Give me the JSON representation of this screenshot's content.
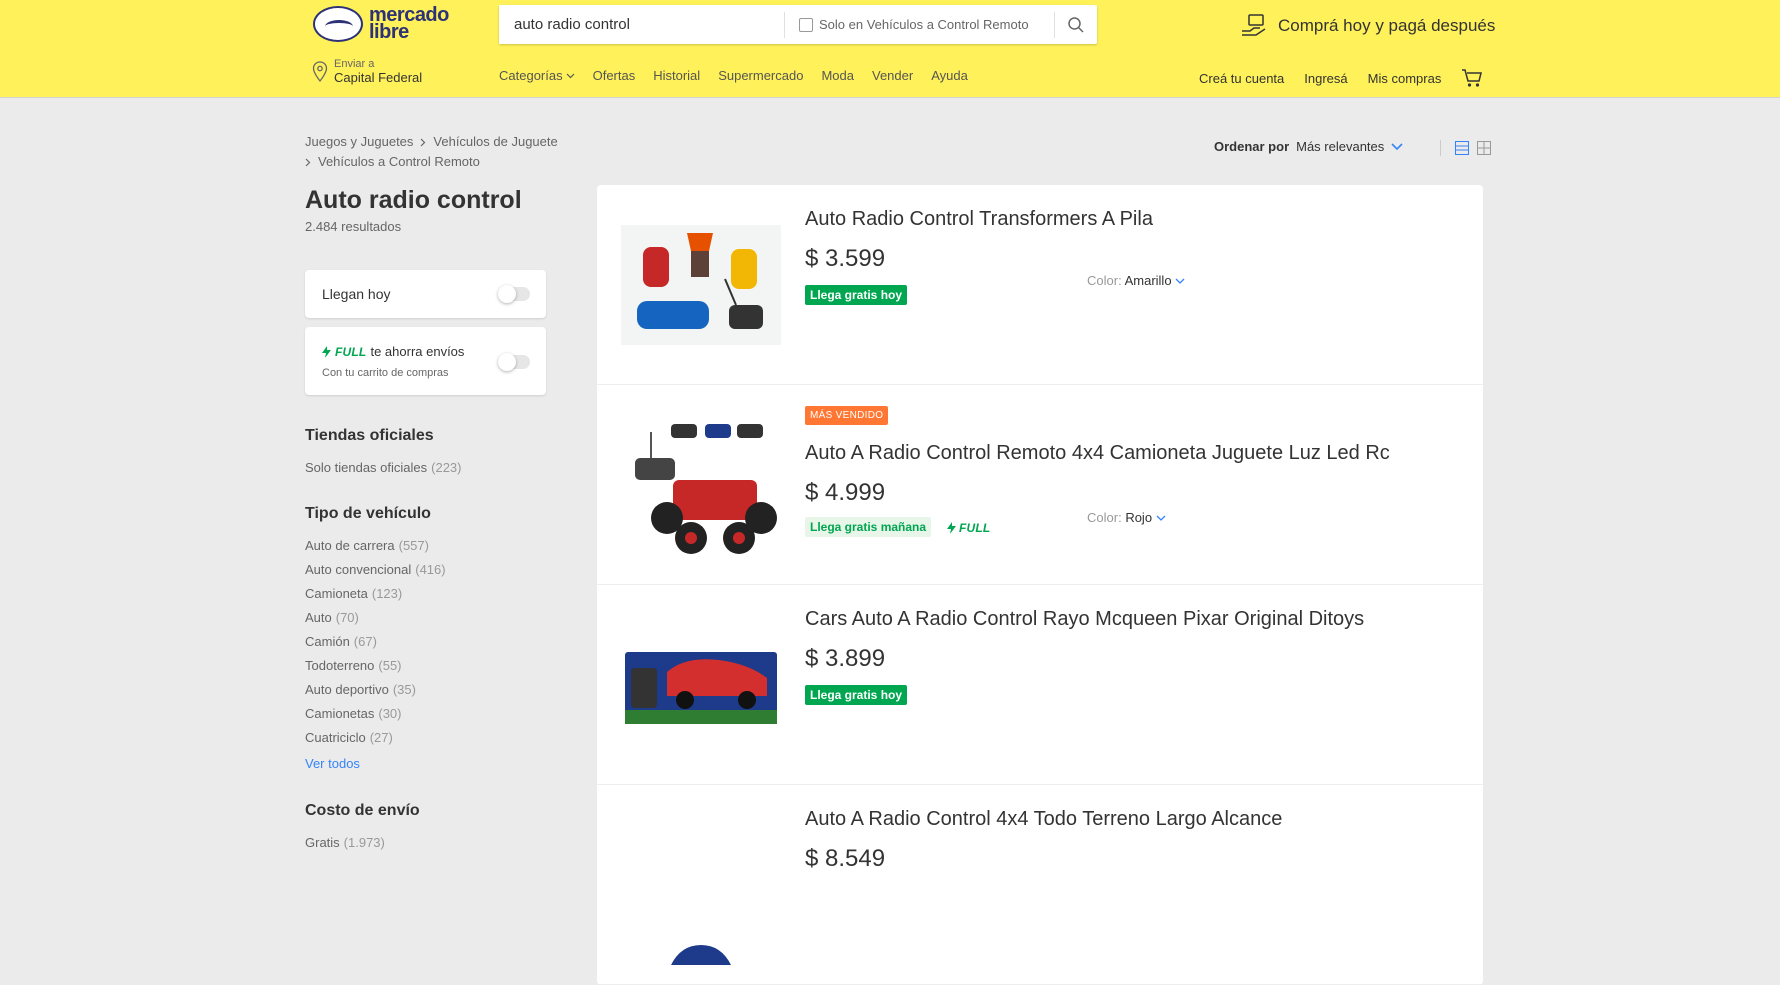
{
  "header": {
    "logo_text_1": "mercado",
    "logo_text_2": "libre",
    "search_value": "auto radio control",
    "search_checkbox_label": "Solo en Vehículos a Control Remoto",
    "promo_text": "Comprá hoy y pagá después",
    "location_label": "Enviar a",
    "location_value": "Capital Federal",
    "nav": [
      "Categorías",
      "Ofertas",
      "Historial",
      "Supermercado",
      "Moda",
      "Vender",
      "Ayuda"
    ],
    "user_nav": [
      "Creá tu cuenta",
      "Ingresá",
      "Mis compras"
    ]
  },
  "breadcrumb": {
    "line1": [
      "Juegos y Juguetes",
      "Vehículos de Juguete"
    ],
    "line2": "Vehículos a Control Remoto"
  },
  "page": {
    "title": "Auto radio control",
    "results": "2.484 resultados"
  },
  "filters": {
    "llegan_hoy": "Llegan hoy",
    "full_tag": "FULL",
    "full_label": "te ahorra envíos",
    "full_sub": "Con tu carrito de compras"
  },
  "sidebar": {
    "tiendas": {
      "title": "Tiendas oficiales",
      "items": [
        {
          "label": "Solo tiendas oficiales",
          "count": "(223)"
        }
      ]
    },
    "tipo": {
      "title": "Tipo de vehículo",
      "items": [
        {
          "label": "Auto de carrera",
          "count": "(557)"
        },
        {
          "label": "Auto convencional",
          "count": "(416)"
        },
        {
          "label": "Camioneta",
          "count": "(123)"
        },
        {
          "label": "Auto",
          "count": "(70)"
        },
        {
          "label": "Camión",
          "count": "(67)"
        },
        {
          "label": "Todoterreno",
          "count": "(55)"
        },
        {
          "label": "Auto deportivo",
          "count": "(35)"
        },
        {
          "label": "Camionetas",
          "count": "(30)"
        },
        {
          "label": "Cuatriciclo",
          "count": "(27)"
        }
      ],
      "ver_todos": "Ver todos"
    },
    "envio": {
      "title": "Costo de envío",
      "items": [
        {
          "label": "Gratis",
          "count": "(1.973)"
        }
      ]
    }
  },
  "sort": {
    "label": "Ordenar por",
    "value": "Más relevantes"
  },
  "items": [
    {
      "title": "Auto Radio Control Transformers A Pila",
      "price": "$ 3.599",
      "shipping": "Llega gratis hoy",
      "color_label": "Color:",
      "color_value": "Amarillo"
    },
    {
      "badge": "MÁS VENDIDO",
      "title": "Auto A Radio Control Remoto 4x4 Camioneta Juguete Luz Led Rc",
      "price": "$ 4.999",
      "shipping": "Llega gratis mañana",
      "full": "FULL",
      "color_label": "Color:",
      "color_value": "Rojo"
    },
    {
      "title": "Cars Auto A Radio Control Rayo Mcqueen Pixar Original Ditoys",
      "price": "$ 3.899",
      "shipping": "Llega gratis hoy"
    },
    {
      "title": "Auto A Radio Control 4x4 Todo Terreno Largo Alcance",
      "price": "$ 8.549"
    }
  ],
  "colors": {
    "brand_yellow": "#fff159",
    "link_blue": "#3483fa",
    "green": "#00a650",
    "badge_orange": "#ff7733"
  }
}
